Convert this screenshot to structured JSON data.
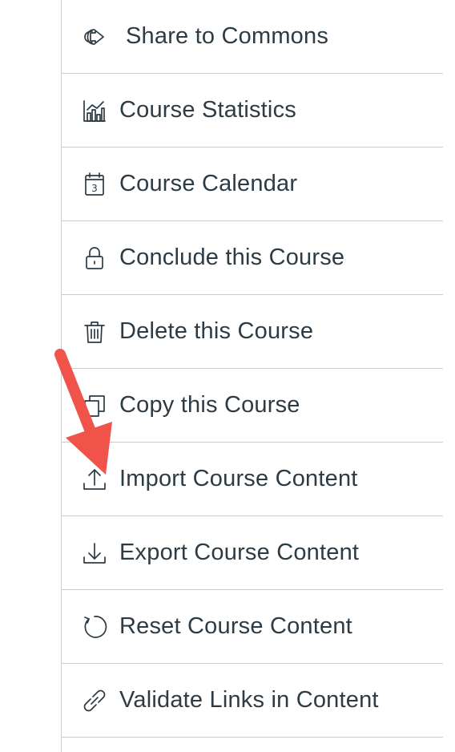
{
  "menu": {
    "items": [
      {
        "label": "Share to Commons",
        "icon": "share-commons-icon"
      },
      {
        "label": "Course Statistics",
        "icon": "statistics-icon"
      },
      {
        "label": "Course Calendar",
        "icon": "calendar-icon"
      },
      {
        "label": "Conclude this Course",
        "icon": "lock-icon"
      },
      {
        "label": "Delete this Course",
        "icon": "trash-icon"
      },
      {
        "label": "Copy this Course",
        "icon": "copy-icon"
      },
      {
        "label": "Import Course Content",
        "icon": "upload-icon"
      },
      {
        "label": "Export Course Content",
        "icon": "download-icon"
      },
      {
        "label": "Reset Course Content",
        "icon": "reset-icon"
      },
      {
        "label": "Validate Links in Content",
        "icon": "link-icon"
      }
    ]
  },
  "calendar_icon_day": "3",
  "annotation": {
    "arrow_color": "#f0534a",
    "points_to": "Import Course Content"
  },
  "colors": {
    "text": "#2d3b45",
    "divider": "#c7cdd1"
  }
}
